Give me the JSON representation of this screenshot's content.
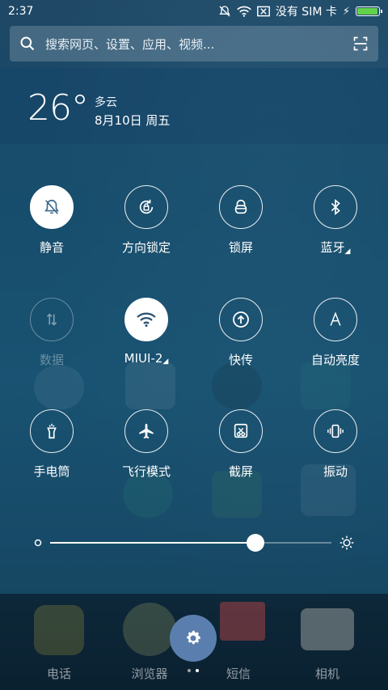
{
  "status": {
    "time": "2:37",
    "carrier": "没有 SIM 卡",
    "battery_level": 0.98
  },
  "search": {
    "placeholder": "搜索网页、设置、应用、视频..."
  },
  "weather": {
    "temperature": "26°",
    "condition": "多云",
    "date": "8月10日 周五"
  },
  "quick_settings": {
    "tiles": [
      {
        "label": "静音",
        "state": "on",
        "icon": "bell-off-icon"
      },
      {
        "label": "方向锁定",
        "state": "off",
        "icon": "rotation-lock-icon"
      },
      {
        "label": "锁屏",
        "state": "off",
        "icon": "lock-icon"
      },
      {
        "label": "蓝牙",
        "state": "off",
        "icon": "bluetooth-icon",
        "expandable": true
      },
      {
        "label": "数据",
        "state": "disabled",
        "icon": "data-arrows-icon"
      },
      {
        "label": "MIUI-2",
        "state": "on",
        "icon": "wifi-icon",
        "expandable": true
      },
      {
        "label": "快传",
        "state": "off",
        "icon": "upload-icon"
      },
      {
        "label": "自动亮度",
        "state": "off",
        "icon": "auto-brightness-icon"
      },
      {
        "label": "手电筒",
        "state": "off",
        "icon": "flashlight-icon"
      },
      {
        "label": "飞行模式",
        "state": "off",
        "icon": "airplane-icon"
      },
      {
        "label": "截屏",
        "state": "off",
        "icon": "screenshot-icon"
      },
      {
        "label": "振动",
        "state": "off",
        "icon": "vibrate-icon"
      }
    ]
  },
  "brightness": {
    "level": 0.73
  },
  "dock": {
    "apps": [
      "电话",
      "浏览器",
      "短信",
      "相机"
    ]
  },
  "colors": {
    "accent": "#5a7fae",
    "battery": "#62d24a"
  }
}
